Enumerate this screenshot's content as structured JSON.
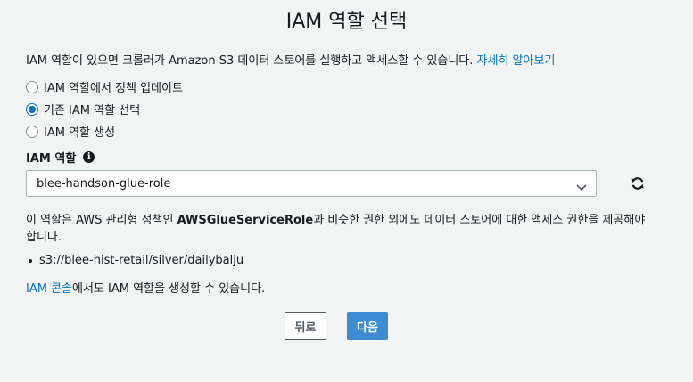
{
  "header": {
    "title": "IAM 역할 선택"
  },
  "intro": {
    "text": "IAM 역할이 있으면 크롤러가 Amazon S3 데이터 스토어를 실행하고 액세스할 수 있습니다.",
    "link": "자세히 알아보기"
  },
  "options": [
    {
      "label": "IAM 역할에서 정책 업데이트",
      "checked": false
    },
    {
      "label": "기존 IAM 역할 선택",
      "checked": true
    },
    {
      "label": "IAM 역할 생성",
      "checked": false
    }
  ],
  "field": {
    "label": "IAM 역할",
    "info_icon": "info-icon",
    "value": "blee-handson-glue-role"
  },
  "description": {
    "before": "이 역할은 AWS 관리형 정책인 ",
    "policy": "AWSGlueServiceRole",
    "after": "과 비슷한 권한 외에도 데이터 스토어에 대한 액세스 권한을 제공해야 합니다."
  },
  "bullets": [
    "s3://blee-hist-retail/silver/dailybalju"
  ],
  "console_note": {
    "link": "IAM 콘솔",
    "text": "에서도 IAM 역할을 생성할 수 있습니다."
  },
  "buttons": {
    "back": "뒤로",
    "next": "다음"
  },
  "colors": {
    "accent": "#0073bb",
    "primary_button": "#3d8bd0",
    "background": "#f2f3f3"
  }
}
